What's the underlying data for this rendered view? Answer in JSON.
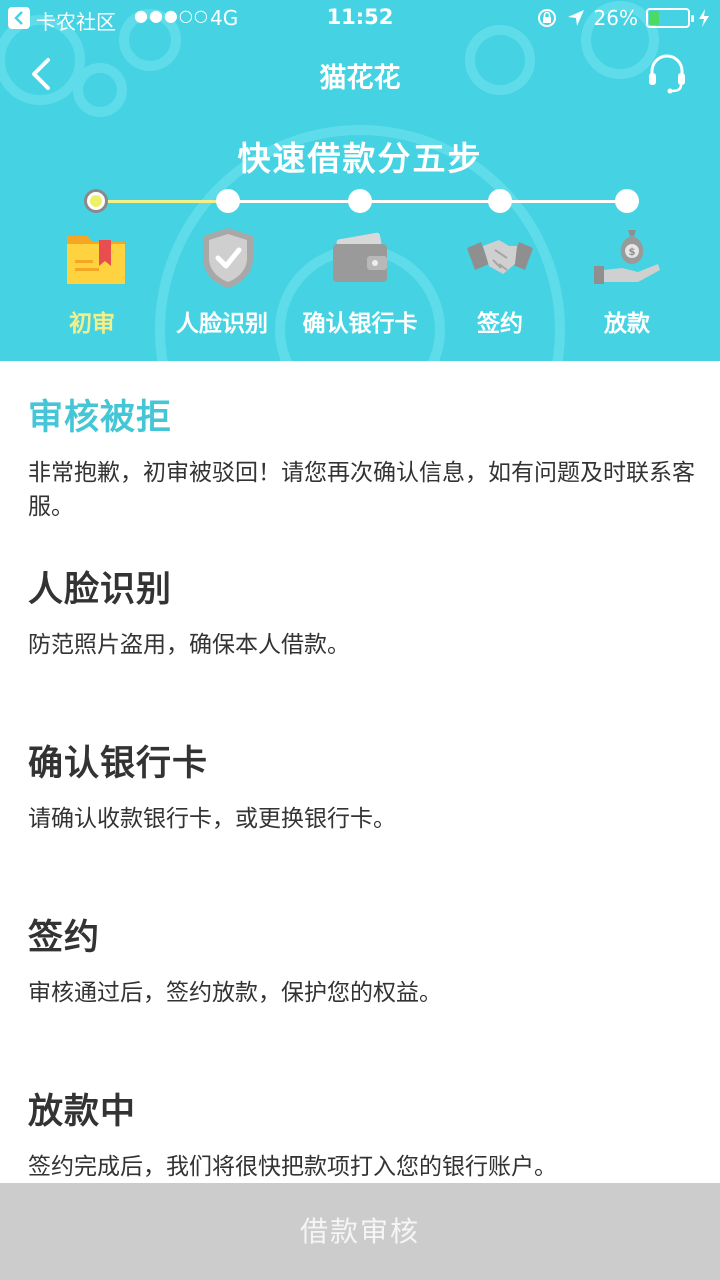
{
  "status_bar": {
    "carrier": "卡农社区",
    "signal": "●●●○○",
    "network": "4G",
    "time": "11:52",
    "battery_text": "26%",
    "battery_level": 0.26
  },
  "nav": {
    "title": "猫花花"
  },
  "steps": {
    "title": "快速借款分五步",
    "current_index": 0,
    "items": [
      {
        "label": "初审",
        "icon": "folder-icon"
      },
      {
        "label": "人脸识别",
        "icon": "shield-icon"
      },
      {
        "label": "确认银行卡",
        "icon": "wallet-icon"
      },
      {
        "label": "签约",
        "icon": "handshake-icon"
      },
      {
        "label": "放款",
        "icon": "money-bag-hand-icon"
      }
    ]
  },
  "blocks": [
    {
      "title": "审核被拒",
      "desc": "非常抱歉，初审被驳回！请您再次确认信息，如有问题及时联系客服。"
    },
    {
      "title": "人脸识别",
      "desc": "防范照片盗用，确保本人借款。"
    },
    {
      "title": "确认银行卡",
      "desc": "请确认收款银行卡，或更换银行卡。"
    },
    {
      "title": "签约",
      "desc": "审核通过后，签约放款，保护您的权益。"
    },
    {
      "title": "放款中",
      "desc": "签约完成后，我们将很快把款项打入您的银行账户。"
    }
  ],
  "bottom_button": {
    "label": "借款审核"
  },
  "colors": {
    "header_bg": "#45d3e3",
    "accent": "#45c6d6",
    "active_step": "#f3f08a",
    "button_bg": "#cccccc"
  }
}
